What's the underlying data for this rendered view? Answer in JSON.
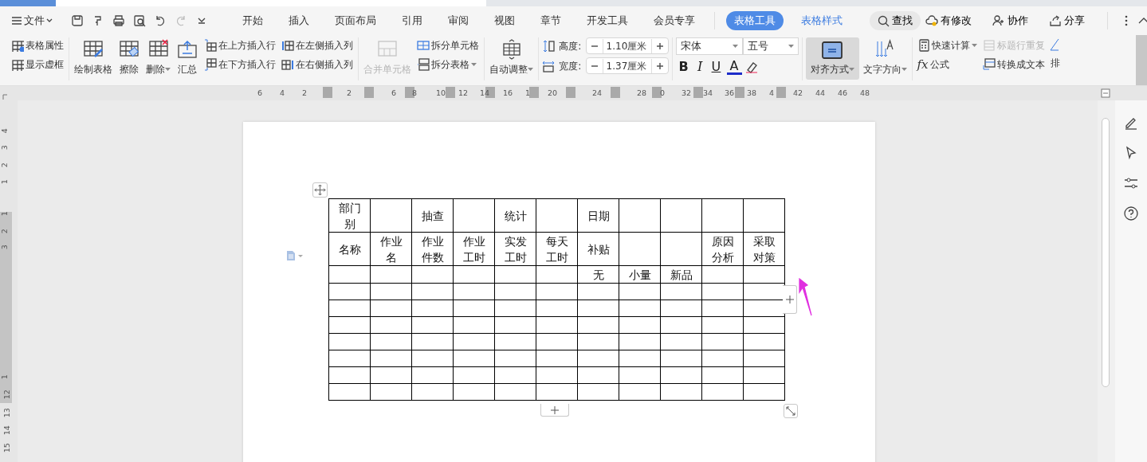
{
  "menu_bar": {
    "file_menu": "文件",
    "tabs": [
      {
        "label": "开始",
        "selected": false,
        "kind": "main"
      },
      {
        "label": "插入",
        "selected": false,
        "kind": "main"
      },
      {
        "label": "页面布局",
        "selected": false,
        "kind": "main"
      },
      {
        "label": "引用",
        "selected": false,
        "kind": "main"
      },
      {
        "label": "审阅",
        "selected": false,
        "kind": "main"
      },
      {
        "label": "视图",
        "selected": false,
        "kind": "main"
      },
      {
        "label": "章节",
        "selected": false,
        "kind": "main"
      },
      {
        "label": "开发工具",
        "selected": false,
        "kind": "main"
      },
      {
        "label": "会员专享",
        "selected": false,
        "kind": "main"
      },
      {
        "label": "表格工具",
        "selected": true,
        "kind": "context"
      },
      {
        "label": "表格样式",
        "selected": false,
        "kind": "context"
      }
    ],
    "search": "查找",
    "actions": [
      {
        "label": "有修改",
        "kind": "cloud"
      },
      {
        "label": "协作",
        "kind": "user"
      },
      {
        "label": "分享",
        "kind": "share"
      }
    ]
  },
  "ribbon": {
    "table_properties": "表格属性",
    "show_gridlines": "显示虚框",
    "large_buttons": [
      {
        "label": "绘制表格",
        "kind": "draw",
        "dropdown": false
      },
      {
        "label": "擦除",
        "kind": "erase",
        "dropdown": false
      },
      {
        "label": "删除",
        "kind": "delete",
        "dropdown": true
      },
      {
        "label": "汇总",
        "kind": "sum",
        "dropdown": false
      }
    ],
    "insert_buttons": [
      {
        "label": "在上方插入行",
        "kind": "row_above"
      },
      {
        "label": "在下方插入行",
        "kind": "row_below"
      },
      {
        "label": "在左侧插入列",
        "kind": "col_left"
      },
      {
        "label": "在右侧插入列",
        "kind": "col_right"
      }
    ],
    "merge_cells": {
      "label": "合并单元格",
      "disabled": true
    },
    "split_cells": "拆分单元格",
    "split_table": "拆分表格",
    "auto_fit": "自动调整",
    "height": {
      "label": "高度:",
      "value": "1.10厘米"
    },
    "width": {
      "label": "宽度:",
      "value": "1.37厘米"
    },
    "font": {
      "family": "宋体",
      "size": "五号"
    },
    "format_buttons": [
      {
        "label": "B",
        "kind": "bold"
      },
      {
        "label": "I",
        "kind": "italic"
      },
      {
        "label": "U",
        "kind": "underline"
      },
      {
        "label": "A",
        "kind": "color"
      }
    ],
    "alignment": {
      "label": "对齐方式",
      "selected": true
    },
    "text_direction": "文字方向",
    "quick_calc": "快速计算",
    "repeat_header": {
      "label": "标题行重复",
      "disabled": true
    },
    "formula": {
      "symbol": "fx",
      "label": "公式"
    },
    "convert_to_text": "转换成文本",
    "sort_cut": "排"
  },
  "ruler": {
    "horizontal": [
      "6",
      "4",
      "2",
      "2",
      "6",
      "8",
      "10",
      "12",
      "14",
      "16",
      "1",
      "20",
      "24",
      "28",
      "0",
      "32",
      "34",
      "36",
      "38",
      "4",
      "42",
      "44",
      "46",
      "48"
    ],
    "vertical": [
      "4",
      "3",
      "2",
      "1",
      "1",
      "2",
      "3",
      "1",
      "12",
      "13",
      "14",
      "15"
    ]
  },
  "table": {
    "rows": [
      [
        "部门别",
        null,
        "抽查",
        null,
        "统计",
        null,
        "日期",
        null,
        null,
        null,
        null
      ],
      [
        "名称",
        "作业名",
        "作业件数",
        "作业工时",
        "实发工时",
        "每天工时",
        "补贴",
        null,
        null,
        "原因分析",
        "采取对策"
      ],
      [
        null,
        null,
        null,
        null,
        null,
        null,
        "无",
        "小量",
        "新品",
        null,
        null
      ],
      [
        null,
        null,
        null,
        null,
        null,
        null,
        null,
        null,
        null,
        null,
        null
      ],
      [
        null,
        null,
        null,
        null,
        null,
        null,
        null,
        null,
        null,
        null,
        null
      ],
      [
        null,
        null,
        null,
        null,
        null,
        null,
        null,
        null,
        null,
        null,
        null
      ],
      [
        null,
        null,
        null,
        null,
        null,
        null,
        null,
        null,
        null,
        null,
        null
      ],
      [
        null,
        null,
        null,
        null,
        null,
        null,
        null,
        null,
        null,
        null,
        null
      ],
      [
        null,
        null,
        null,
        null,
        null,
        null,
        null,
        null,
        null,
        null,
        null
      ],
      [
        null,
        null,
        null,
        null,
        null,
        null,
        null,
        null,
        null,
        null,
        null
      ]
    ]
  }
}
